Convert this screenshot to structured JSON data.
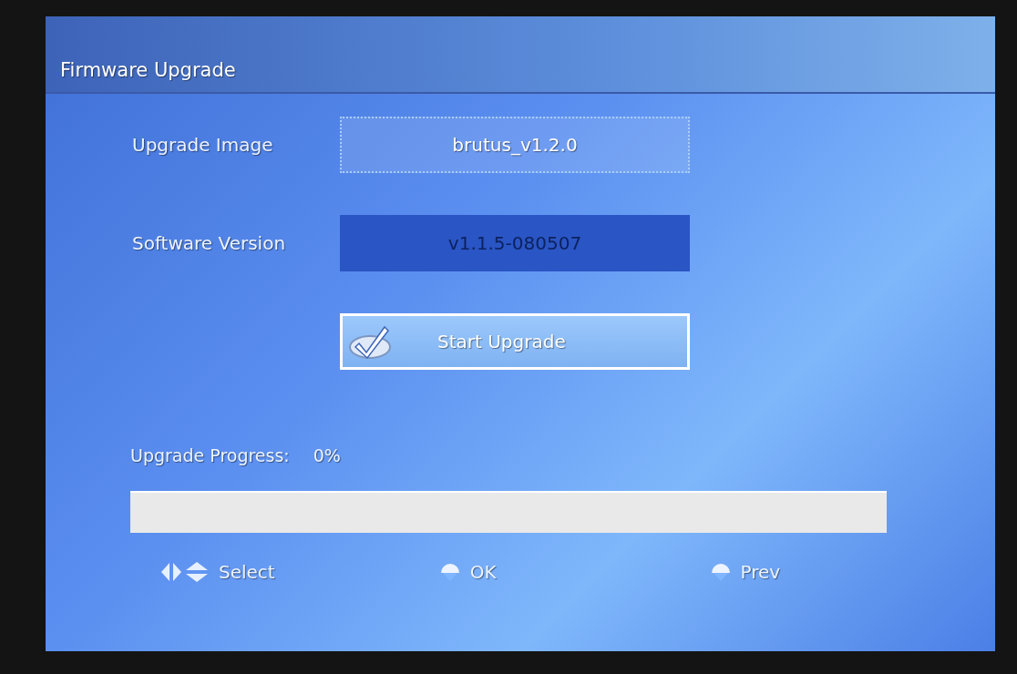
{
  "header": {
    "title": "Firmware Upgrade"
  },
  "fields": [
    {
      "label": "Upgrade Image",
      "value": "brutus_v1.2.0",
      "kind": "select"
    },
    {
      "label": "Software Version",
      "value": "v1.1.5-080507",
      "kind": "readonly"
    }
  ],
  "action_button": {
    "label": "Start Upgrade",
    "focused": true
  },
  "progress": {
    "label": "Upgrade Progress:",
    "reading": "0%",
    "level": 0
  },
  "footer": [
    {
      "kind": "arrows",
      "label": "Select"
    },
    {
      "kind": "ok",
      "label": "OK"
    },
    {
      "kind": "menu",
      "label": "Prev"
    }
  ]
}
